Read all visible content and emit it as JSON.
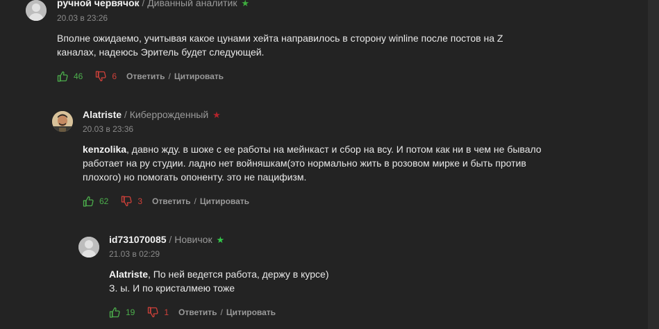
{
  "comments": [
    {
      "author": "ручной червячок",
      "sep": "/",
      "rank": "Диванный аналитик",
      "star_color": "#3fae3f",
      "date": "20.03 в 23:26",
      "text_line1": "Вполне ожидаемо, учитывая какое цунами хейта направилось в сторону winline после постов на Z",
      "text_line2": "каналах, надеюсь Эритель будет следующей.",
      "likes": "46",
      "dislikes": "6",
      "reply": "Ответить",
      "action_sep": "/",
      "quote": "Цитировать"
    },
    {
      "author": "Alatriste",
      "sep": "/",
      "rank": "Киберрожденный",
      "star_color": "#b3242c",
      "date": "20.03 в 23:36",
      "mention": "kenzolika",
      "text_line1_rest": ", давно жду. в шоке с ее работы на мейнкаст и сбор на всу. И потом как ни в чем не бывало",
      "text_line2": "работает на ру студии. ладно нет войняшкам(это нормально жить в розовом мирке и быть против",
      "text_line3": "плохого) но помогать опоненту. это не пацифизм.",
      "likes": "62",
      "dislikes": "3",
      "reply": "Ответить",
      "action_sep": "/",
      "quote": "Цитировать"
    },
    {
      "author": "id731070085",
      "sep": "/",
      "rank": "Новичок",
      "star_color": "#33c84a",
      "date": "21.03 в 02:29",
      "mention": "Alatriste",
      "text_line1_rest": ", По ней ведется работа, держу в курсе)",
      "text_line2": "З. ы. И по кристалмею тоже",
      "likes": "19",
      "dislikes": "1",
      "reply": "Ответить",
      "action_sep": "/",
      "quote": "Цитировать"
    }
  ],
  "icons": {
    "star": "★",
    "like_color": "#4cae4c",
    "dislike_color": "#d0413a"
  }
}
